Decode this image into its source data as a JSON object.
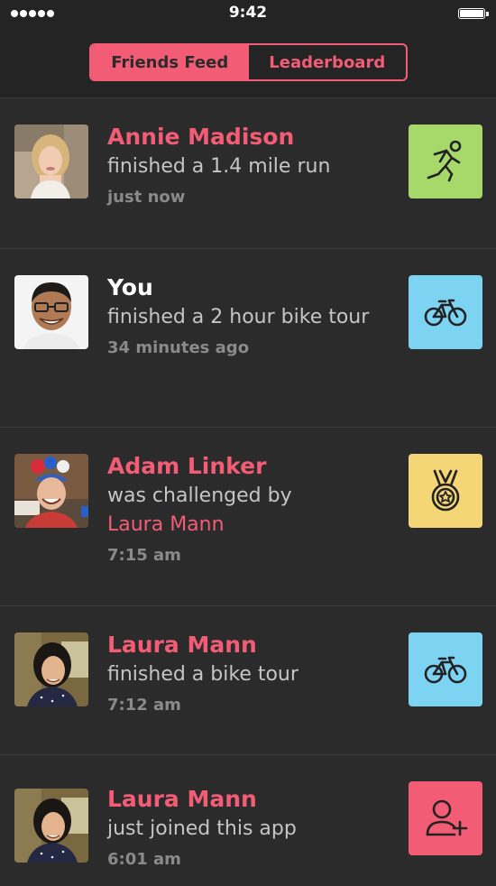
{
  "status_bar": {
    "time": "9:42"
  },
  "nav": {
    "tabs": [
      {
        "label": "Friends Feed",
        "active": true
      },
      {
        "label": "Leaderboard",
        "active": false
      }
    ]
  },
  "colors": {
    "accent": "#f25c75",
    "background": "#2b2b2c",
    "run_green": "#a6d86a",
    "bike_blue": "#7dd3f2",
    "medal_yellow": "#f5d677",
    "join_pink": "#f25c75"
  },
  "feed": {
    "items": [
      {
        "name": "Annie Madison",
        "description": "finished a 1.4 mile run",
        "time": "just now",
        "icon": "runner-icon"
      },
      {
        "name": "You",
        "description": "finished a 2 hour bike tour",
        "time": "34 minutes ago",
        "icon": "bike-icon"
      },
      {
        "name": "Adam Linker",
        "description": "was challenged by",
        "mention": "Laura Mann",
        "time": "7:15 am",
        "icon": "medal-icon"
      },
      {
        "name": "Laura Mann",
        "description": "finished a bike tour",
        "time": "7:12 am",
        "icon": "bike-icon"
      },
      {
        "name": "Laura Mann",
        "description": "just joined this app",
        "time": "6:01 am",
        "icon": "add-user-icon"
      }
    ]
  }
}
